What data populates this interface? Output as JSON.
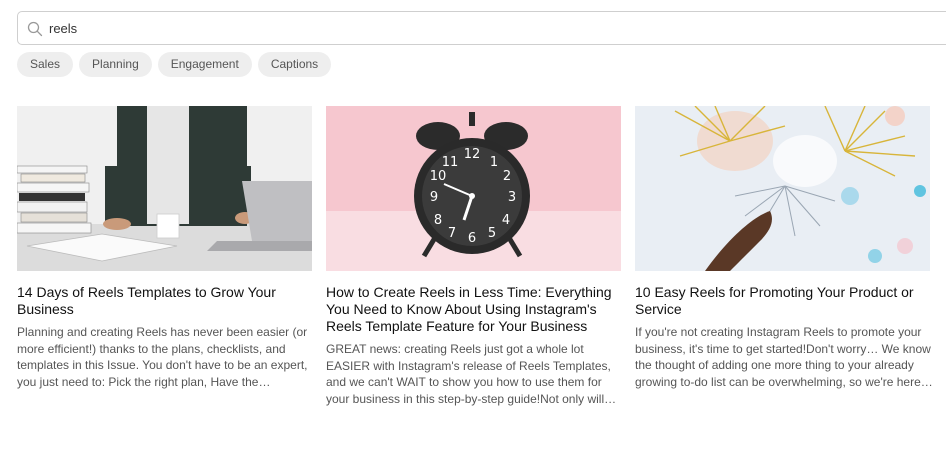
{
  "search": {
    "value": "reels",
    "icon": "search-icon"
  },
  "chips": [
    {
      "label": "Sales"
    },
    {
      "label": "Planning"
    },
    {
      "label": "Engagement"
    },
    {
      "label": "Captions"
    }
  ],
  "cards": [
    {
      "title": "14 Days of Reels Templates to Grow Your Business",
      "excerpt": "Planning and creating Reels has never been easier (or more efficient!) thanks to the plans, checklists, and templates in this Issue. You don't have to be an expert, you just need to: Pick the right plan, Have the…"
    },
    {
      "title": "How to Create Reels in Less Time: Everything You Need to Know About Using Instagram's Reels Template Feature for Your Business",
      "excerpt": "GREAT news: creating Reels just got a whole lot EASIER with Instagram's release of Reels Templates, and we can't WAIT to show you how to use them for your business in this step-by-step guide!Not only will…"
    },
    {
      "title": "10 Easy Reels for Promoting Your Product or Service",
      "excerpt": "If you're not creating Instagram Reels to promote your business, it's time to get started!Don't worry… We know the thought of adding one more thing to your already growing to-do list can be overwhelming, so we're here…"
    }
  ]
}
